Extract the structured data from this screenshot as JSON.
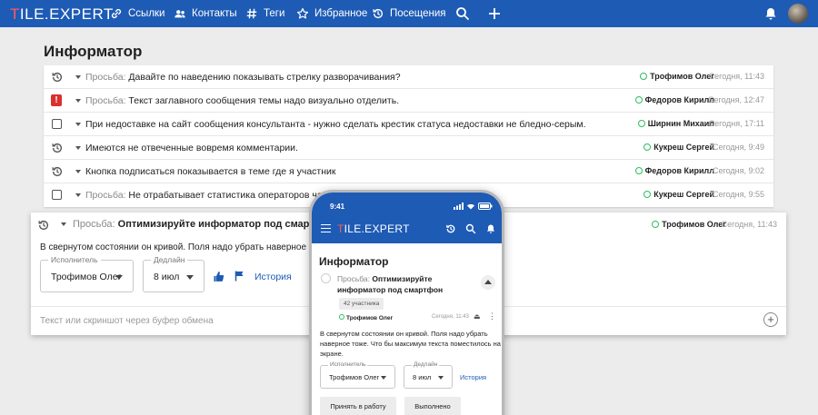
{
  "brand": {
    "logo_main": "ILE.EXPERT",
    "logo_t": "T"
  },
  "nav": [
    {
      "label": "Ссылки",
      "icon": "link-icon"
    },
    {
      "label": "Контакты",
      "icon": "contacts-icon"
    },
    {
      "label": "Теги",
      "icon": "hash-icon"
    },
    {
      "label": "Избранное",
      "icon": "star-icon"
    },
    {
      "label": "Посещения",
      "icon": "history-icon"
    }
  ],
  "page": {
    "title": "Информатор"
  },
  "rows": [
    {
      "status": "clock",
      "prefix": "Просьба:",
      "text": "Давайте по наведению показывать стрелку разворачивания?",
      "who": "Трофимов Олег",
      "time": "Сегодня, 11:43"
    },
    {
      "status": "alert",
      "prefix": "Просьба:",
      "text": "Текст заглавного сообщения темы надо визуально отделить.",
      "who": "Федоров Кирилл",
      "time": "Сегодня, 12:47"
    },
    {
      "status": "checkbox",
      "prefix": "",
      "text": "При недоставке на сайт сообщения консультанта - нужно сделать крестик статуса недоставки не бледно-серым.",
      "who": "Ширнин Михаил",
      "time": "Сегодня, 17:11"
    },
    {
      "status": "clock",
      "prefix": "",
      "text": "Имеются не отвеченные вовремя комментарии.",
      "who": "Кукреш Сергей",
      "time": "Сегодня, 9:49"
    },
    {
      "status": "clock",
      "prefix": "",
      "text": "Кнопка подписаться показывается в теме где я участник",
      "who": "Федоров Кирилл",
      "time": "Сегодня, 9:02"
    },
    {
      "status": "checkbox",
      "prefix": "Просьба:",
      "text": "Не отрабатывает статистика операторов чата",
      "who": "Кукреш Сергей",
      "time": "Сегодня, 9:55"
    }
  ],
  "card": {
    "prefix": "Просьба:",
    "title": "Оптимизируйте информатор под смартфон",
    "who": "Трофимов Олег",
    "time": "Сегодня, 11:43",
    "body": "В свернутом состоянии он кривой. Поля надо убрать наверное тоже. Чт",
    "assignee_label": "Исполнитель",
    "assignee": "Трофимов Олег",
    "deadline_label": "Дедлайн",
    "deadline": "8 июл",
    "history": "История",
    "placeholder": "Текст или скриншот через буфер обмена"
  },
  "phone": {
    "clock": "9:41",
    "title": "Информатор",
    "prefix": "Просьба:",
    "item": "Оптимизируйте информатор под смартфон",
    "badge": "42 участника",
    "who": "Трофимов Олег",
    "time": "Сегодня, 11:43",
    "body": "В свернутом состоянии он кривой. Поля надо убрать наверное тоже. Что бы максимум текста поместилось на экране.",
    "assignee_label": "Исполнитель",
    "assignee": "Трофимов Олег",
    "deadline_label": "Дедлайн",
    "deadline": "8 июл",
    "history": "История",
    "accept": "Принять в работу",
    "done": "Выполнено"
  }
}
